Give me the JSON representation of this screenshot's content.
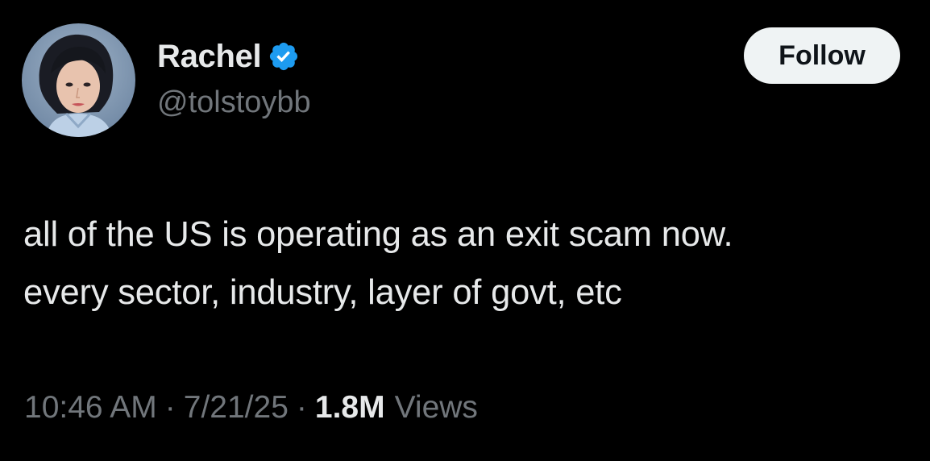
{
  "author": {
    "name": "Rachel",
    "handle": "@tolstoybb",
    "verified": true,
    "badge_icon": "verified-check-icon",
    "badge_color": "#1d9bf0"
  },
  "actions": {
    "follow_label": "Follow"
  },
  "tweet": {
    "lines": [
      "all of the US is operating as an exit scam now.",
      "every sector, industry, layer of govt, etc"
    ]
  },
  "meta": {
    "time": "10:46 AM",
    "separator": "·",
    "date": "7/21/25",
    "views_count": "1.8M",
    "views_label": "Views"
  },
  "colors": {
    "background": "#000000",
    "primary_text": "#e7e9ea",
    "secondary_text": "#71767b",
    "button_bg": "#eff3f4",
    "button_text": "#0f1419"
  }
}
